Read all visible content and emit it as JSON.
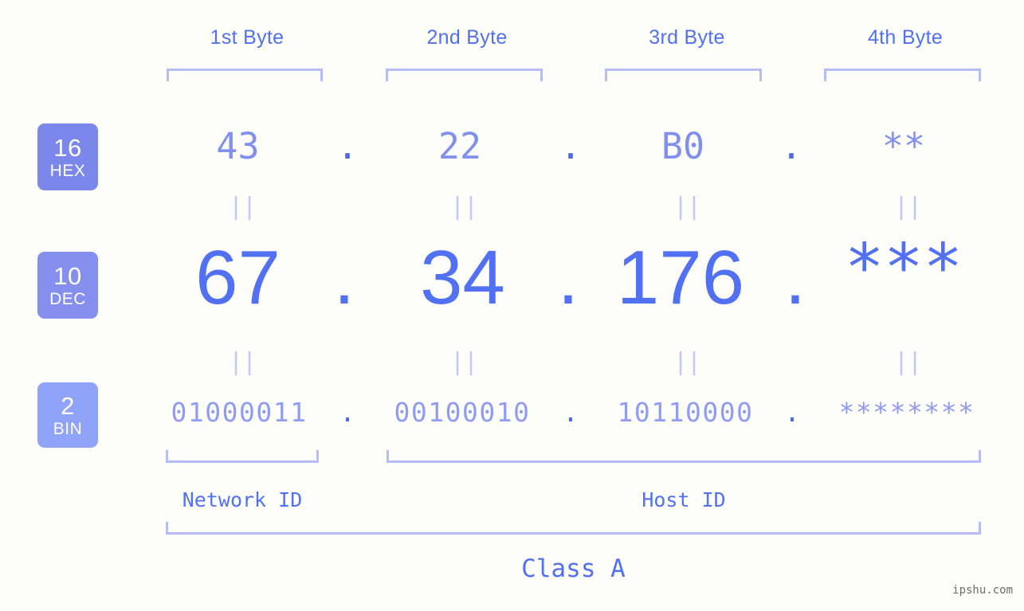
{
  "background_color": "#fdfdfa",
  "accent_color": "#5271f2",
  "muted_accent_color": "#8e9cf5",
  "bracket_color": "#b5bdf6",
  "byte_headers": [
    {
      "label": "1st Byte"
    },
    {
      "label": "2nd Byte"
    },
    {
      "label": "3rd Byte"
    },
    {
      "label": "4th Byte"
    }
  ],
  "rows": [
    {
      "base": "16",
      "abbr": "HEX",
      "badge_color": "#7b87ea",
      "values": [
        "43",
        "22",
        "B0",
        "**"
      ],
      "separator": "."
    },
    {
      "base": "10",
      "abbr": "DEC",
      "badge_color": "#8590ee",
      "values": [
        "67",
        "34",
        "176",
        "***"
      ],
      "separator": "."
    },
    {
      "base": "2",
      "abbr": "BIN",
      "badge_color": "#8fa4f8",
      "values": [
        "01000011",
        "00100010",
        "10110000",
        "********"
      ],
      "separator": "."
    }
  ],
  "equality_marks": {
    "glyph": "||",
    "count_per_row": 4,
    "rows": 2
  },
  "footer": {
    "network_id_label": "Network ID",
    "host_id_label": "Host ID",
    "class_label": "Class A"
  },
  "watermark": "ipshu.com"
}
